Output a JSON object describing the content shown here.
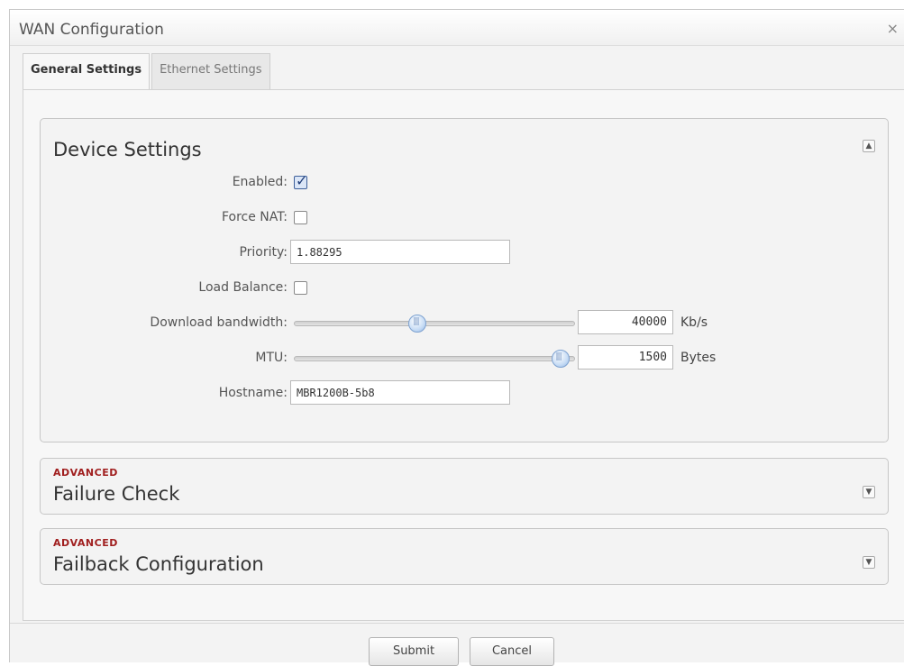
{
  "window": {
    "title": "WAN Configuration",
    "close_glyph": "×"
  },
  "tabs": [
    {
      "label": "General Settings",
      "active": true
    },
    {
      "label": "Ethernet Settings",
      "active": false
    }
  ],
  "device_settings": {
    "title": "Device Settings",
    "toggle_glyph": "▲",
    "enabled": {
      "label": "Enabled:",
      "checked": true
    },
    "force_nat": {
      "label": "Force NAT:",
      "checked": false
    },
    "priority": {
      "label": "Priority:",
      "value": "1.88295"
    },
    "load_balance": {
      "label": "Load Balance:",
      "checked": false
    },
    "download_bandwidth": {
      "label": "Download bandwidth:",
      "value": "40000",
      "unit": "Kb/s",
      "slider_fraction": 0.44
    },
    "mtu": {
      "label": "MTU:",
      "value": "1500",
      "unit": "Bytes",
      "slider_fraction": 0.95
    },
    "hostname": {
      "label": "Hostname:",
      "value": "MBR1200B-5b8"
    }
  },
  "failure_check": {
    "tag": "ADVANCED",
    "title": "Failure Check",
    "toggle_glyph": "▼"
  },
  "failback_configuration": {
    "tag": "ADVANCED",
    "title": "Failback Configuration",
    "toggle_glyph": "▼"
  },
  "footer": {
    "submit_label": "Submit",
    "cancel_label": "Cancel"
  },
  "colors": {
    "advanced_tag": "#a01e1e",
    "slider_handle": "#8fb4e3",
    "checkbox_check": "#223f7a"
  }
}
